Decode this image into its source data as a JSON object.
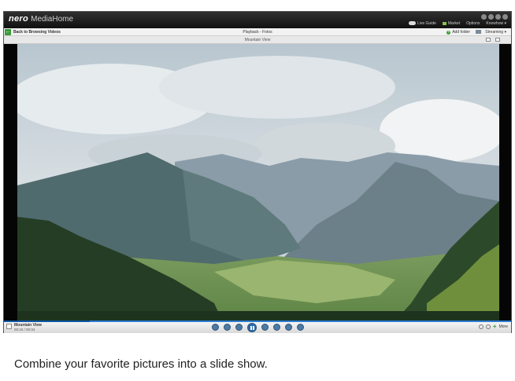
{
  "app": {
    "brand": "nero",
    "product": "MediaHome",
    "menu": {
      "live_guide": "Live Guide",
      "market": "Market",
      "options": "Options",
      "knowhow": "Knowhow"
    }
  },
  "nav": {
    "back_label": "Back to Browsing Videos",
    "title": "Playback - Fotos",
    "add_folder": "Add folder",
    "streaming": "Streaming"
  },
  "subbar": {
    "title": "Mountain View"
  },
  "player": {
    "track_name": "Mountain View",
    "counter": "00:10 / 00:34",
    "more": "More",
    "progress_fraction": 0.17
  },
  "caption": "Combine your favorite pictures into a slide show.",
  "colors": {
    "accent": "#2d7fd3",
    "green": "#3a9b3a",
    "titlebar": "#1a1a1a"
  }
}
